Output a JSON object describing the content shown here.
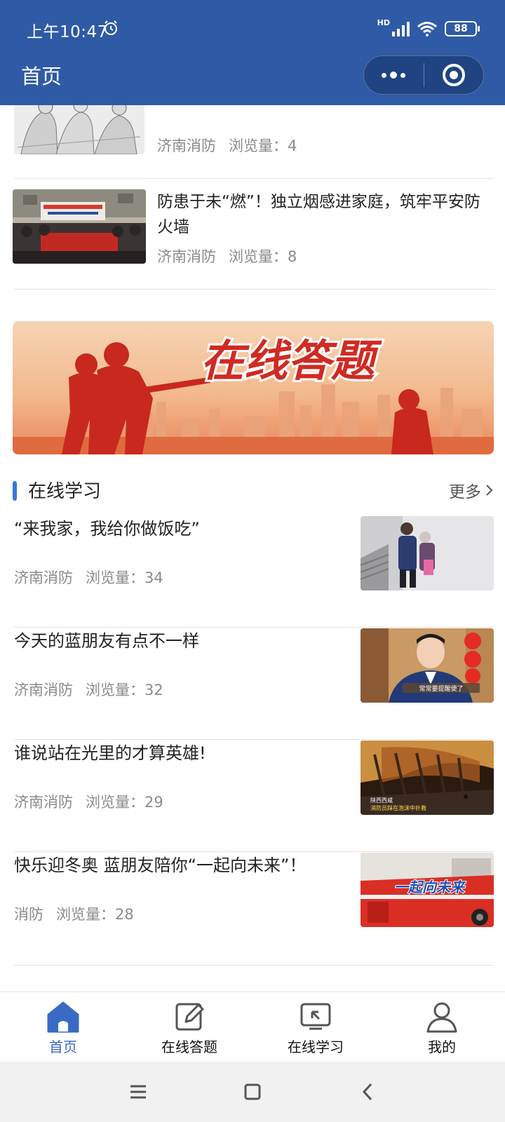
{
  "status_bar": {
    "time": "上午10:47",
    "hd_label": "HD",
    "battery": "88"
  },
  "navbar": {
    "title": "首页"
  },
  "news": [
    {
      "source": "济南消防",
      "views_label": "浏览量：4"
    },
    {
      "title": "防患于未“燃”！独立烟感进家庭，筑牢平安防火墙",
      "source": "济南消防",
      "views_label": "浏览量：8"
    }
  ],
  "banner": {
    "text": "在线答题"
  },
  "learning": {
    "section_title": "在线学习",
    "more_label": "更多",
    "items": [
      {
        "title": "“来我家，我给你做饭吃”",
        "source": "济南消防",
        "views_label": "浏览量：34"
      },
      {
        "title": "今天的蓝朋友有点不一样",
        "source": "济南消防",
        "views_label": "浏览量：32",
        "thumb_caption": "常常要提醒便了"
      },
      {
        "title": "谁说站在光里的才算英雄!",
        "source": "济南消防",
        "views_label": "浏览量：29",
        "thumb_caption_1": "陕西西咸",
        "thumb_caption_2": "消防员踩在泡沫中扑救"
      },
      {
        "title": "快乐迎冬奥 蓝朋友陪你“一起向未来”！",
        "source": "消防",
        "views_label": "浏览量：28",
        "thumb_caption": "一起向未来"
      }
    ]
  },
  "tabbar": {
    "tabs": [
      {
        "label": "首页",
        "icon": "home-icon",
        "active": true
      },
      {
        "label": "在线答题",
        "icon": "edit-icon",
        "active": false
      },
      {
        "label": "在线学习",
        "icon": "screen-icon",
        "active": false
      },
      {
        "label": "我的",
        "icon": "user-icon",
        "active": false
      }
    ]
  },
  "colors": {
    "primary": "#2f5aa5",
    "accent_blue": "#3a79d4",
    "banner_red": "#c8281e"
  }
}
